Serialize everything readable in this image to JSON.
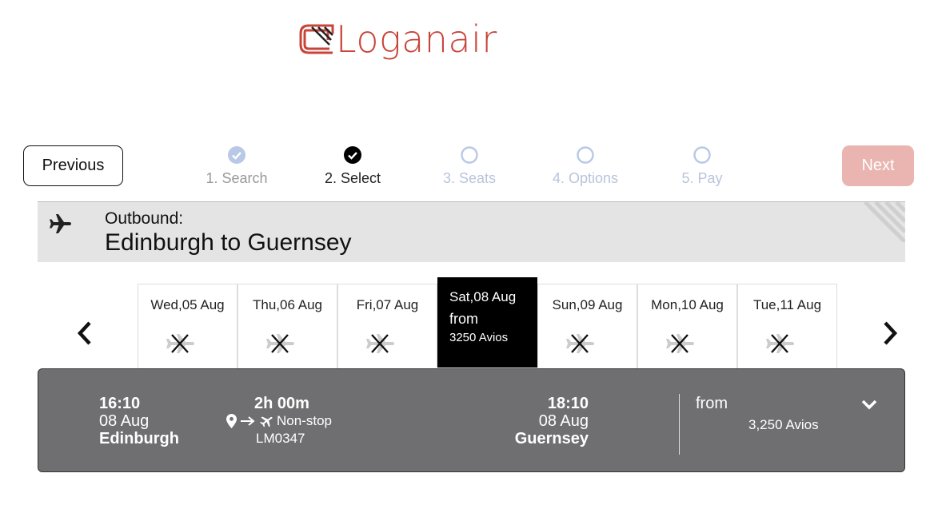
{
  "brand": {
    "name": "Loganair",
    "color": "#c8443a"
  },
  "nav": {
    "previous_label": "Previous",
    "next_label": "Next"
  },
  "steps": [
    {
      "label": "1. Search",
      "state": "done"
    },
    {
      "label": "2. Select",
      "state": "current"
    },
    {
      "label": "3. Seats",
      "state": "todo"
    },
    {
      "label": "4. Options",
      "state": "todo"
    },
    {
      "label": "5. Pay",
      "state": "todo"
    }
  ],
  "outbound": {
    "label": "Outbound:",
    "route": "Edinburgh to Guernsey",
    "icon": "plane-icon"
  },
  "days": [
    {
      "date": "Wed,05 Aug",
      "available": false
    },
    {
      "date": "Thu,06 Aug",
      "available": false
    },
    {
      "date": "Fri,07 Aug",
      "available": false
    },
    {
      "date": "Sat,08 Aug",
      "available": true,
      "from": "from",
      "price": "3250 Avios"
    },
    {
      "date": "Sun,09 Aug",
      "available": false
    },
    {
      "date": "Mon,10 Aug",
      "available": false
    },
    {
      "date": "Tue,11 Aug",
      "available": false
    }
  ],
  "flight": {
    "departure": {
      "time": "16:10",
      "date": "08 Aug",
      "city": "Edinburgh"
    },
    "arrival": {
      "time": "18:10",
      "date": "08 Aug",
      "city": "Guernsey"
    },
    "duration": "2h 00m",
    "stops": "Non-stop",
    "flight_number": "LM0347",
    "from_label": "from",
    "price": "3,250 Avios"
  },
  "colors": {
    "next_disabled": "#eab5b0",
    "step_done": "#b8c8e6",
    "flight_panel": "#6f6f71",
    "selected_day": "#000000"
  }
}
